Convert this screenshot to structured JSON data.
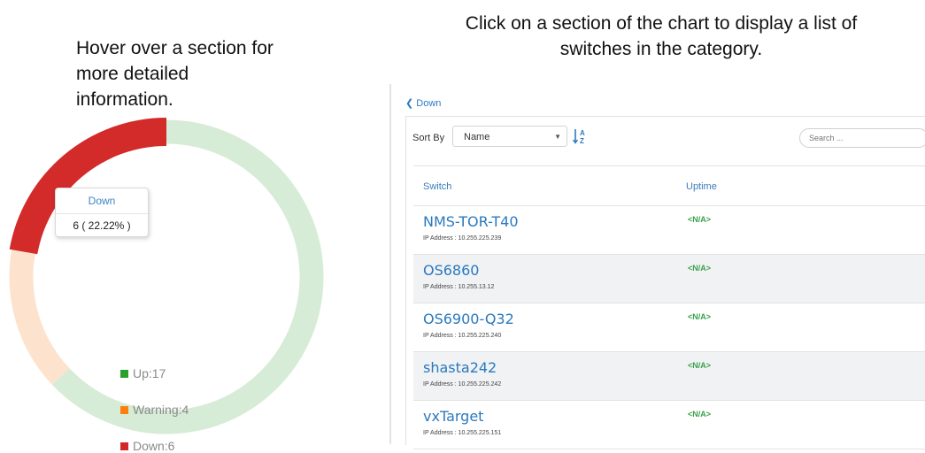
{
  "captions": {
    "left": "Hover over a section for more detailed information.",
    "right": "Click on a section of the chart to display a list of switches in the category."
  },
  "chart_data": {
    "type": "pie",
    "categories": [
      "Up",
      "Warning",
      "Down"
    ],
    "values": [
      17,
      4,
      6
    ],
    "colors": [
      "#d6ecd6",
      "#fde3cd",
      "#d32a2a"
    ],
    "highlight": "Down",
    "legend": [
      {
        "label": "Up:17",
        "color": "#2ca02c"
      },
      {
        "label": "Warning:4",
        "color": "#ff7f0e"
      },
      {
        "label": "Down:6",
        "color": "#d62728"
      }
    ],
    "tooltip": {
      "title": "Down",
      "value": "6 ( 22.22% )"
    }
  },
  "panel": {
    "back_label": "Down",
    "sort_by_label": "Sort By",
    "sort_value": "Name",
    "search_placeholder": "Search ...",
    "columns": [
      "Switch",
      "Uptime"
    ],
    "rows": [
      {
        "name": "NMS-TOR-T40",
        "ip": "IP Address : 10.255.225.239",
        "uptime": "<N/A>"
      },
      {
        "name": "OS6860",
        "ip": "IP Address : 10.255.13.12",
        "uptime": "<N/A>"
      },
      {
        "name": "OS6900-Q32",
        "ip": "IP Address : 10.255.225.240",
        "uptime": "<N/A>"
      },
      {
        "name": "shasta242",
        "ip": "IP Address : 10.255.225.242",
        "uptime": "<N/A>"
      },
      {
        "name": "vxTarget",
        "ip": "IP Address : 10.255.225.151",
        "uptime": "<N/A>"
      }
    ]
  }
}
